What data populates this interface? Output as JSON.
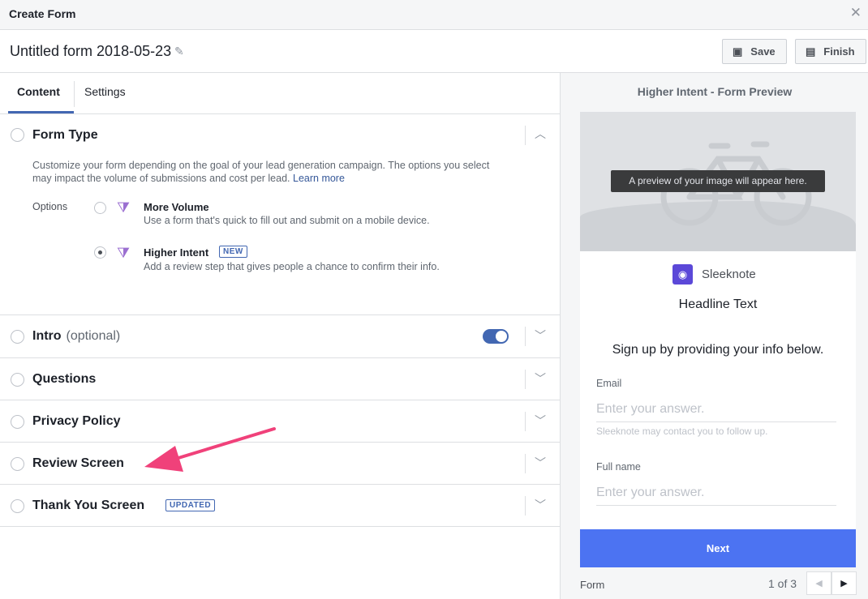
{
  "window": {
    "title": "Create Form"
  },
  "header": {
    "form_name": "Untitled form 2018-05-23",
    "save_label": "Save",
    "finish_label": "Finish"
  },
  "tabs": [
    {
      "label": "Content",
      "active": true
    },
    {
      "label": "Settings",
      "active": false
    }
  ],
  "form_type": {
    "title": "Form Type",
    "description": "Customize your form depending on the goal of your lead generation campaign. The options you select may impact the volume of submissions and cost per lead.",
    "learn_more": "Learn more",
    "options_label": "Options",
    "options": [
      {
        "name": "More Volume",
        "description": "Use a form that's quick to fill out and submit on a mobile device.",
        "selected": false
      },
      {
        "name": "Higher Intent",
        "badge": "NEW",
        "description": "Add a review step that gives people a chance to confirm their info.",
        "selected": true
      }
    ]
  },
  "sections": {
    "intro": {
      "title": "Intro",
      "note": "(optional)",
      "enabled": true
    },
    "questions": {
      "title": "Questions"
    },
    "privacy": {
      "title": "Privacy Policy"
    },
    "review": {
      "title": "Review Screen"
    },
    "thankyou": {
      "title": "Thank You Screen",
      "badge": "UPDATED"
    }
  },
  "preview": {
    "title": "Higher Intent - Form Preview",
    "image_placeholder": "A preview of your image will appear here.",
    "brand_name": "Sleeknote",
    "headline": "Headline Text",
    "signup_text": "Sign up by providing your info below.",
    "fields": [
      {
        "label": "Email",
        "placeholder": "Enter your answer.",
        "help": "Sleeknote may contact you to follow up."
      },
      {
        "label": "Full name",
        "placeholder": "Enter your answer."
      }
    ],
    "next_label": "Next",
    "footer_label": "Form",
    "pager": "1 of 3"
  },
  "colors": {
    "accent": "#4267b2",
    "next_button": "#4c73f2",
    "annotation_arrow": "#f0417a",
    "brand_logo": "#5b48d8"
  },
  "icons": {
    "close": "close-icon",
    "edit": "pencil-icon",
    "save": "save-icon",
    "finish": "finish-icon",
    "collapse": "chevron-up-icon",
    "expand": "chevron-down-icon"
  }
}
